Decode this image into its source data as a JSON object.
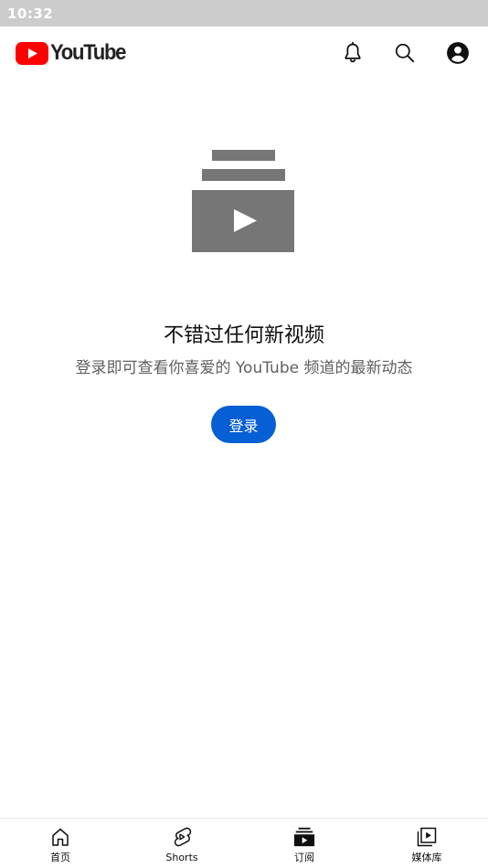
{
  "status_bar": {
    "time": "10:32"
  },
  "header": {
    "logo_text": "YouTube",
    "icons": [
      "notifications-icon",
      "search-icon",
      "account-icon"
    ]
  },
  "empty_state": {
    "icon": "subscriptions-stack-icon",
    "title": "不错过任何新视频",
    "subtitle": "登录即可查看你喜爱的 YouTube 频道的最新动态",
    "signin_label": "登录"
  },
  "bottom_nav": {
    "items": [
      {
        "label": "首页",
        "icon": "home-icon"
      },
      {
        "label": "Shorts",
        "icon": "shorts-icon"
      },
      {
        "label": "订阅",
        "icon": "subscriptions-icon",
        "selected": true
      },
      {
        "label": "媒体库",
        "icon": "library-icon"
      }
    ]
  },
  "colors": {
    "brand_red": "#ff0000",
    "button_blue": "#065fd4",
    "illustration_gray": "#767676",
    "status_bar": "#cccccc"
  }
}
